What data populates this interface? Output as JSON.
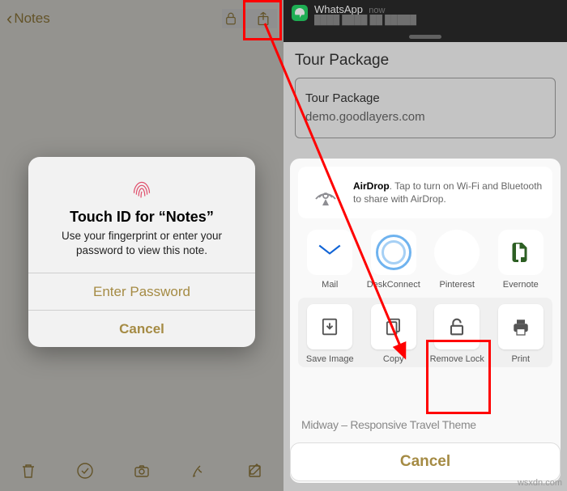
{
  "left": {
    "back_label": "Notes",
    "alert": {
      "title": "Touch ID for “Notes”",
      "message": "Use your fingerprint or enter your password to view this note.",
      "enter_password": "Enter Password",
      "cancel": "Cancel"
    }
  },
  "right": {
    "notification": {
      "app": "WhatsApp",
      "time": "now",
      "preview": "████ ████ ██ █████"
    },
    "page": {
      "title": "Tour Package",
      "card_title": "Tour Package",
      "card_sub": "demo.goodlayers.com",
      "peek": "Midway – Responsive Travel Theme"
    },
    "airdrop_label": "AirDrop",
    "airdrop_text": ". Tap to turn on Wi-Fi and Bluetooth to share with AirDrop.",
    "apps": {
      "mail": "Mail",
      "desk": "DeskConnect",
      "pinterest": "Pinterest",
      "evernote": "Evernote"
    },
    "actions": {
      "save": "Save Image",
      "copy": "Copy",
      "remove": "Remove Lock",
      "print": "Print"
    },
    "cancel": "Cancel"
  },
  "watermark": "wsxdn.com"
}
